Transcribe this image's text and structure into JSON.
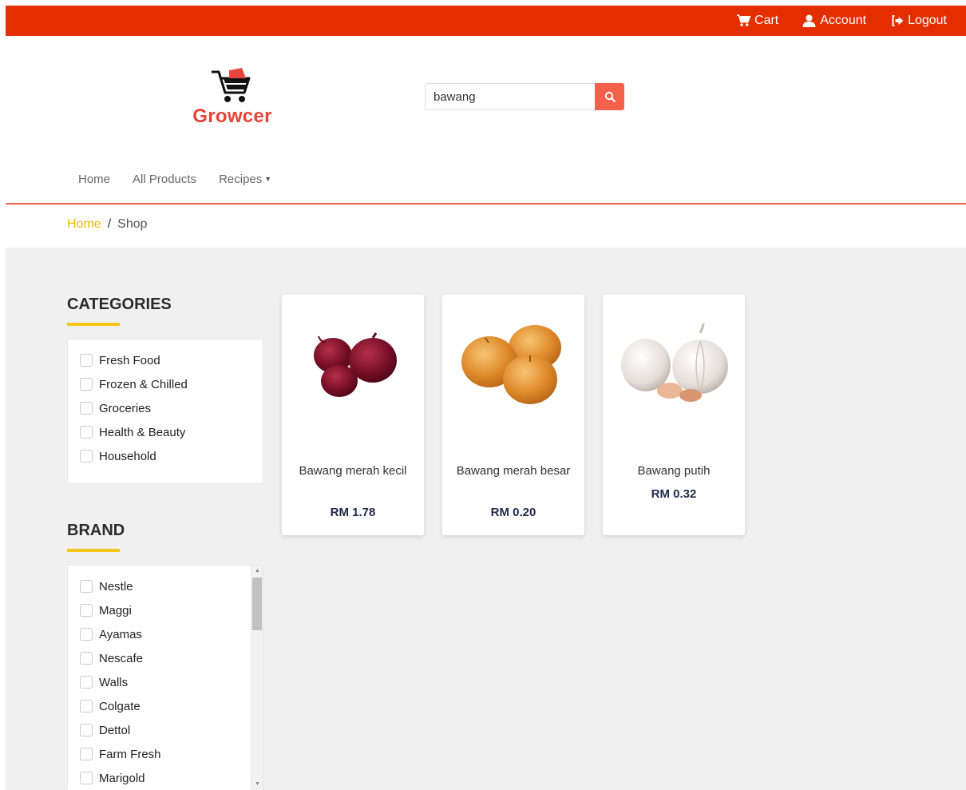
{
  "topbar": {
    "cart_label": "Cart",
    "account_label": "Account",
    "logout_label": "Logout",
    "background": "#e52e00"
  },
  "logo": {
    "text": "Growcer",
    "color": "#e5453a"
  },
  "search": {
    "value": "bawang",
    "button_color": "#f4604a"
  },
  "nav": {
    "home": "Home",
    "all_products": "All Products",
    "recipes": "Recipes"
  },
  "breadcrumb": {
    "home": "Home",
    "separator": "/",
    "current": "Shop"
  },
  "categories": {
    "title": "CATEGORIES",
    "items": [
      "Fresh Food",
      "Frozen & Chilled",
      "Groceries",
      "Health & Beauty",
      "Household"
    ]
  },
  "brand": {
    "title": "BRAND",
    "items": [
      "Nestle",
      "Maggi",
      "Ayamas",
      "Nescafe",
      "Walls",
      "Colgate",
      "Dettol",
      "Farm Fresh",
      "Marigold"
    ]
  },
  "products": [
    {
      "name": "Bawang merah kecil",
      "price": "RM 1.78",
      "image": "red-onion-icon"
    },
    {
      "name": "Bawang merah besar",
      "price": "RM 0.20",
      "image": "yellow-onion-icon"
    },
    {
      "name": "Bawang putih",
      "price": "RM 0.32",
      "image": "garlic-icon"
    }
  ],
  "colors": {
    "accent_yellow": "#f5c518",
    "accent_red": "#f4604a",
    "price_navy": "#1c2a4a"
  }
}
